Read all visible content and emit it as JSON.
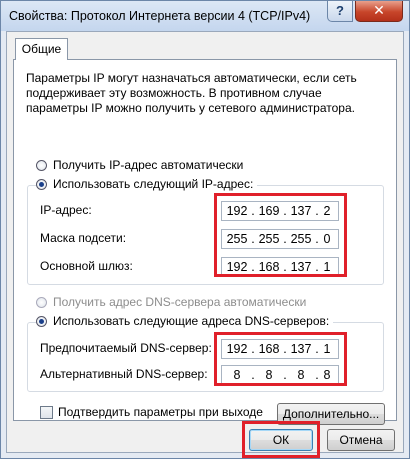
{
  "window": {
    "title": "Свойства: Протокол Интернета версии 4 (TCP/IPv4)",
    "help_label": "?",
    "close_label": "✕"
  },
  "tabs": [
    {
      "label": "Общие",
      "selected": true
    }
  ],
  "intro_text": "Параметры IP могут назначаться автоматически, если сеть поддерживает эту возможность. В противном случае параметры IP можно получить у сетевого администратора.",
  "ip_section": {
    "auto_label": "Получить IP-адрес автоматически",
    "manual_label": "Использовать следующий IP-адрес:",
    "manual_selected": true,
    "fields": [
      {
        "label": "IP-адрес:",
        "octets": [
          "192",
          "169",
          "137",
          "2"
        ]
      },
      {
        "label": "Маска подсети:",
        "octets": [
          "255",
          "255",
          "255",
          "0"
        ]
      },
      {
        "label": "Основной шлюз:",
        "octets": [
          "192",
          "168",
          "137",
          "1"
        ]
      }
    ]
  },
  "dns_section": {
    "auto_label": "Получить адрес DNS-сервера автоматически",
    "auto_enabled": false,
    "manual_label": "Использовать следующие адреса DNS-серверов:",
    "manual_selected": true,
    "fields": [
      {
        "label": "Предпочитаемый DNS-сервер:",
        "octets": [
          "192",
          "168",
          "137",
          "1"
        ]
      },
      {
        "label": "Альтернативный DNS-сервер:",
        "octets": [
          "8",
          "8",
          "8",
          "8"
        ]
      }
    ]
  },
  "validate_checkbox": {
    "label": "Подтвердить параметры при выходе",
    "checked": false
  },
  "buttons": {
    "advanced": "Дополнительно...",
    "ok": "ОК",
    "cancel": "Отмена"
  },
  "highlight_color": "#e0202a"
}
